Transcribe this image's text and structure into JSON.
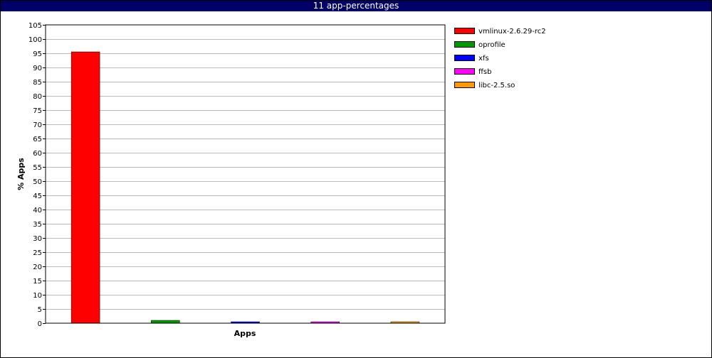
{
  "window": {
    "title": "11 app-percentages"
  },
  "chart_data": {
    "type": "bar",
    "title": "11 app-percentages",
    "xlabel": "Apps",
    "ylabel": "% Apps",
    "ylim": [
      0,
      105
    ],
    "ytick_step": 5,
    "grid": true,
    "legend_position": "right",
    "series": [
      {
        "name": "vmlinux-2.6.29-rc2",
        "value": 95.5,
        "color": "#ff0000"
      },
      {
        "name": "oprofile",
        "value": 1.0,
        "color": "#009900"
      },
      {
        "name": "xfs",
        "value": 0.5,
        "color": "#0000ff"
      },
      {
        "name": "ffsb",
        "value": 0.5,
        "color": "#ff00ff"
      },
      {
        "name": "libc-2.5.so",
        "value": 0.5,
        "color": "#ff9900"
      }
    ]
  }
}
